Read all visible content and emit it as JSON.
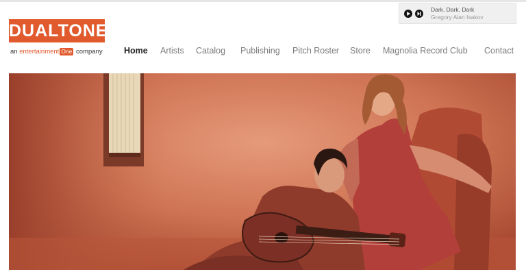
{
  "player": {
    "track_title": "Dark, Dark, Dark",
    "track_artist": "Gregory Alan Isakov",
    "play_icon": "play-icon",
    "next_icon": "skip-next-icon"
  },
  "brand": {
    "logo_text": "DUALTONE",
    "tagline_prefix": "an ",
    "tagline_entertainment": "entertainment",
    "tagline_one": "One",
    "tagline_suffix": " company",
    "accent_color": "#e15a2d"
  },
  "nav": {
    "items": [
      {
        "label": "Home",
        "active": true
      },
      {
        "label": "Artists"
      },
      {
        "label": "Catalog"
      },
      {
        "label": "Publishing"
      },
      {
        "label": "Pitch Roster"
      },
      {
        "label": "Store"
      },
      {
        "label": "Magnolia Record Club"
      },
      {
        "label": "Contact"
      }
    ]
  },
  "hero": {
    "description_colors": {
      "wall": "#c96e4e",
      "shadow": "#8a3a28"
    }
  }
}
